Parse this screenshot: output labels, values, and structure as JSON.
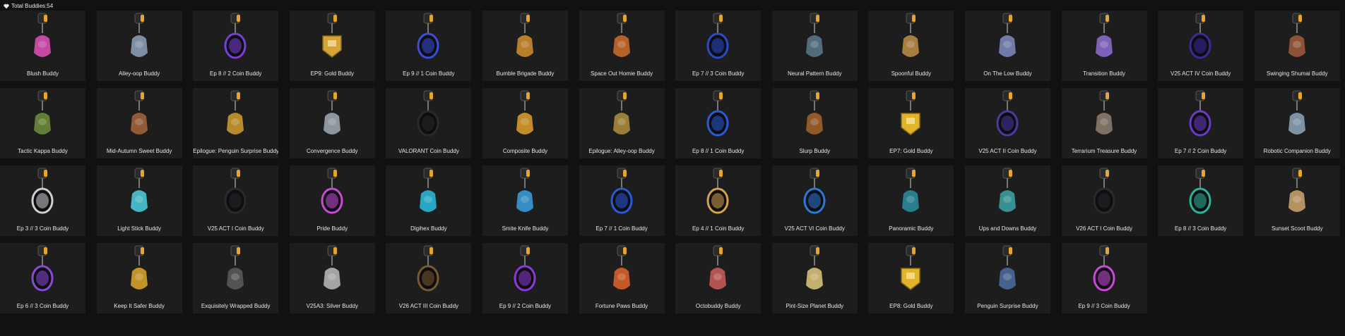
{
  "header": {
    "label": "Total Buddies:54",
    "icon": "heart-icon"
  },
  "accent_colors": {
    "clip_gold": "#e7a52a",
    "card_bg": "#1d1d1d",
    "page_bg": "#111111"
  },
  "buddies": [
    {
      "name": "Blush Buddy",
      "icon": "blush-eye-charm-icon",
      "color": "#d64fb3"
    },
    {
      "name": "Alley-oop Buddy",
      "icon": "basketball-hoop-charm-icon",
      "color": "#8a9bb4"
    },
    {
      "name": "Ep 8 // 2 Coin Buddy",
      "icon": "coin-charm-icon",
      "color": "#7b3fd6",
      "badge": "EP8"
    },
    {
      "name": "EP9: Gold Buddy",
      "icon": "gold-shield-charm-icon",
      "color": "#d4a33a",
      "badge": "EP 9"
    },
    {
      "name": "Ep 9 // 1 Coin Buddy",
      "icon": "coin-charm-icon",
      "color": "#3a4fd6",
      "badge": "EP9"
    },
    {
      "name": "Bumble Brigade Buddy",
      "icon": "beehive-charm-icon",
      "color": "#c98a2e"
    },
    {
      "name": "Space Out Homie Buddy",
      "icon": "space-homie-charm-icon",
      "color": "#c66a2a"
    },
    {
      "name": "Ep 7 // 3 Coin Buddy",
      "icon": "coin-charm-icon",
      "color": "#2a4bc9",
      "badge": "EP7"
    },
    {
      "name": "Neural Pattern Buddy",
      "icon": "neural-pattern-charm-icon",
      "color": "#5a7586"
    },
    {
      "name": "Spoonful Buddy",
      "icon": "spoon-charm-icon",
      "color": "#b78a45"
    },
    {
      "name": "On The Low Buddy",
      "icon": "lowrider-charm-icon",
      "color": "#7a86b8"
    },
    {
      "name": "Transition Buddy",
      "icon": "transition-charm-icon",
      "color": "#8a6ac9"
    },
    {
      "name": "V25 ACT IV Coin Buddy",
      "icon": "coin-charm-icon",
      "color": "#3a2a9b",
      "badge": "V25"
    },
    {
      "name": "Swinging Shumai Buddy",
      "icon": "shumai-basket-charm-icon",
      "color": "#9b5a3a"
    },
    {
      "name": "Tactic Kappa Buddy",
      "icon": "kappa-charm-icon",
      "color": "#6a8a3a"
    },
    {
      "name": "Mid-Autumn Sweet Buddy",
      "icon": "mooncake-charm-icon",
      "color": "#a0623a"
    },
    {
      "name": "Epilogue: Penguin Surprise Buddy",
      "icon": "gold-penguin-charm-icon",
      "color": "#c9982e"
    },
    {
      "name": "Convergence Buddy",
      "icon": "convergence-charm-icon",
      "color": "#9aa3ad"
    },
    {
      "name": "VALORANT Coin Buddy",
      "icon": "valorant-coin-charm-icon",
      "color": "#2a2a2a",
      "badge": "V"
    },
    {
      "name": "Composite Buddy",
      "icon": "composite-charm-icon",
      "color": "#d49a2a"
    },
    {
      "name": "Epilogue: Alley-oop Buddy",
      "icon": "gold-hoop-charm-icon",
      "color": "#a68a3a"
    },
    {
      "name": "Ep 8 // 1 Coin Buddy",
      "icon": "coin-charm-icon",
      "color": "#2a5bd6",
      "badge": "EP8"
    },
    {
      "name": "Slurp Buddy",
      "icon": "slurp-cup-charm-icon",
      "color": "#a0602a"
    },
    {
      "name": "EP7: Gold Buddy",
      "icon": "gold-shield-charm-icon",
      "color": "#e0b52a",
      "badge": "EP7"
    },
    {
      "name": "V25 ACT II Coin Buddy",
      "icon": "coin-charm-icon",
      "color": "#4a3aa0",
      "badge": "V25"
    },
    {
      "name": "Terrarium Treasure Buddy",
      "icon": "terrarium-charm-icon",
      "color": "#8a7a6a"
    },
    {
      "name": "Ep 7 // 2 Coin Buddy",
      "icon": "coin-charm-icon",
      "color": "#6a3ac9",
      "badge": "EP7"
    },
    {
      "name": "Robotic Companion Buddy",
      "icon": "robot-dog-charm-icon",
      "color": "#8aa0b4"
    },
    {
      "name": "Ep 3 // 3 Coin Buddy",
      "icon": "coin-charm-icon",
      "color": "#cfcfcf",
      "badge": "EP3"
    },
    {
      "name": "Light Stick Buddy",
      "icon": "light-stick-charm-icon",
      "color": "#4ac8d6"
    },
    {
      "name": "V25 ACT I Coin Buddy",
      "icon": "coin-charm-icon",
      "color": "#2a2a2a",
      "badge": "V25"
    },
    {
      "name": "Pride Buddy",
      "icon": "pride-coin-charm-icon",
      "color": "#c94ad6",
      "badge": "V"
    },
    {
      "name": "Digihex Buddy",
      "icon": "digihex-charm-icon",
      "color": "#2ab6d6"
    },
    {
      "name": "Smite Knife Buddy",
      "icon": "knife-charm-icon",
      "color": "#3a9ad6"
    },
    {
      "name": "Ep 7 // 1 Coin Buddy",
      "icon": "coin-charm-icon",
      "color": "#2a5bd6",
      "badge": "EP7"
    },
    {
      "name": "Ep 4 // 1 Coin Buddy",
      "icon": "coin-charm-icon",
      "color": "#d6a24a",
      "badge": "EP4"
    },
    {
      "name": "V25 ACT VI Coin Buddy",
      "icon": "coin-charm-icon",
      "color": "#2a7ad6",
      "badge": "V25"
    },
    {
      "name": "Panoramic Buddy",
      "icon": "feather-charm-icon",
      "color": "#2a8a9a"
    },
    {
      "name": "Ups and Downs Buddy",
      "icon": "ferris-wheel-charm-icon",
      "color": "#3aa0a0"
    },
    {
      "name": "V26 ACT I Coin Buddy",
      "icon": "coin-charm-icon",
      "color": "#2a2a2a",
      "badge": "V26"
    },
    {
      "name": "Ep 8 // 3 Coin Buddy",
      "icon": "coin-charm-icon",
      "color": "#2ab69a",
      "badge": "EP8"
    },
    {
      "name": "Sunset Scoot Buddy",
      "icon": "scooter-charm-icon",
      "color": "#c6a06a"
    },
    {
      "name": "Ep 6 // 3 Coin Buddy",
      "icon": "coin-charm-icon",
      "color": "#8a4ad6",
      "badge": "EP6"
    },
    {
      "name": "Keep It Safer Buddy",
      "icon": "padlock-charm-icon",
      "color": "#d4a12a"
    },
    {
      "name": "Exquisitely Wrapped Buddy",
      "icon": "gift-box-charm-icon",
      "color": "#5a5a5a"
    },
    {
      "name": "V25A3: Silver Buddy",
      "icon": "silver-diamond-charm-icon",
      "color": "#b4b4b4"
    },
    {
      "name": "V26 ACT III Coin Buddy",
      "icon": "coin-charm-icon",
      "color": "#7a5a2a",
      "badge": "2026"
    },
    {
      "name": "Ep 9 // 2 Coin Buddy",
      "icon": "coin-charm-icon",
      "color": "#8a3ad6",
      "badge": "EP9"
    },
    {
      "name": "Fortune Paws Buddy",
      "icon": "fortune-cat-charm-icon",
      "color": "#d6602a"
    },
    {
      "name": "Octobuddy Buddy",
      "icon": "octopus-charm-icon",
      "color": "#c65a5a"
    },
    {
      "name": "Pint-Size Planet Buddy",
      "icon": "planet-charm-icon",
      "color": "#d6c07a"
    },
    {
      "name": "EP8: Gold Buddy",
      "icon": "gold-shield-charm-icon",
      "color": "#e0b52a",
      "badge": "EP8"
    },
    {
      "name": "Penguin Surprise Buddy",
      "icon": "penguin-charm-icon",
      "color": "#4a6a9a"
    },
    {
      "name": "Ep 9 // 3 Coin Buddy",
      "icon": "coin-charm-icon",
      "color": "#c94ad6",
      "badge": "EP9"
    }
  ]
}
